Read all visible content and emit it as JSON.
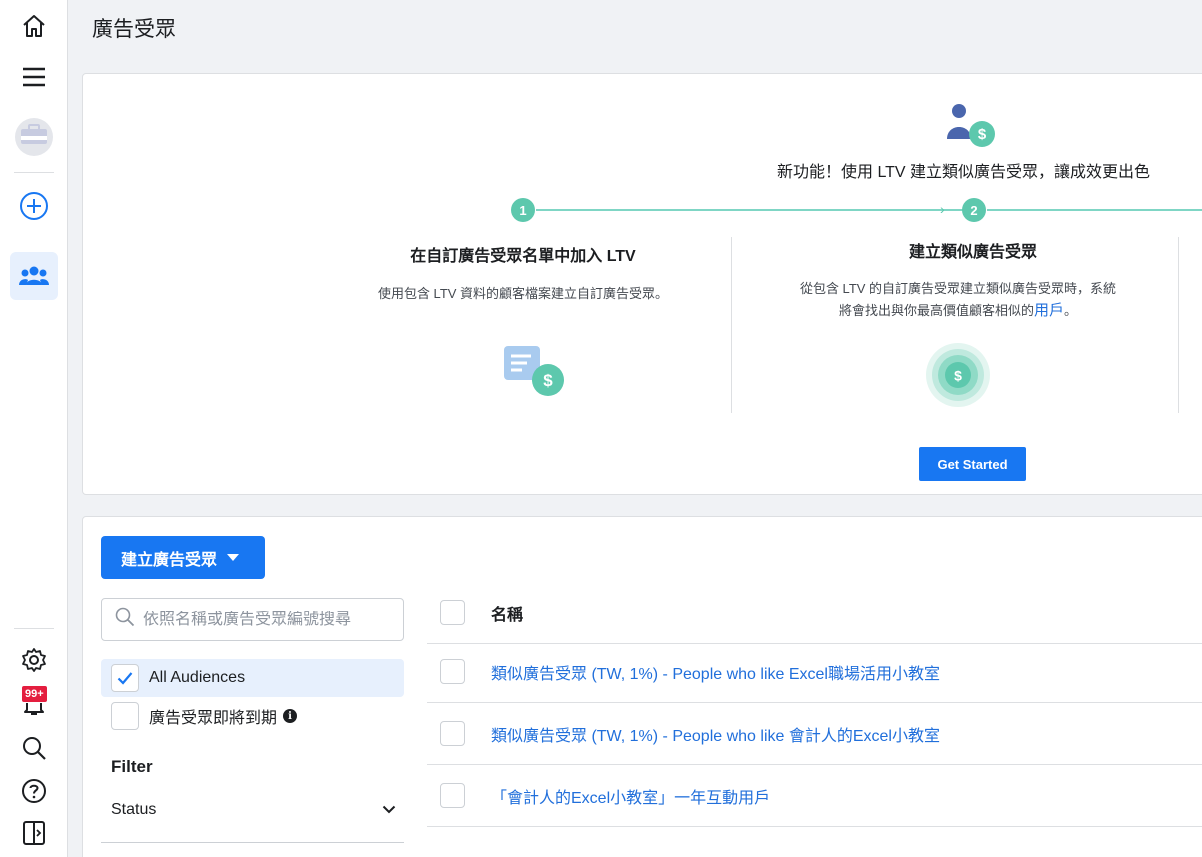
{
  "page": {
    "title": "廣告受眾"
  },
  "rail": {
    "items": [
      {
        "name": "home-icon"
      },
      {
        "name": "menu-icon"
      },
      {
        "name": "account-avatar"
      },
      {
        "name": "create-icon"
      },
      {
        "name": "audiences-icon",
        "active": true
      }
    ],
    "bottom": [
      {
        "name": "settings-icon"
      },
      {
        "name": "notifications-icon"
      },
      {
        "name": "search-icon"
      },
      {
        "name": "help-icon"
      },
      {
        "name": "panel-toggle-icon"
      }
    ],
    "notification_badge": "99+"
  },
  "promo": {
    "headline": "新功能！使用 LTV 建立類似廣告受眾，讓成效更出色",
    "steps": [
      {
        "number": "1",
        "title": "在自訂廣告受眾名單中加入 LTV",
        "description": "使用包含 LTV 資料的顧客檔案建立自訂廣告受眾。"
      },
      {
        "number": "2",
        "title": "建立類似廣告受眾",
        "description_line1": "從包含 LTV 的自訂廣告受眾建立類似廣告受眾時，系統",
        "description_line2": "將會找出與你最高價值顧客相似的",
        "description_link": "用戶",
        "description_end": "。"
      }
    ],
    "cta": "Get Started"
  },
  "audiences": {
    "create_button": "建立廣告受眾",
    "search_placeholder": "依照名稱或廣告受眾編號搜尋",
    "views": [
      {
        "label": "All Audiences",
        "checked": true
      },
      {
        "label": "廣告受眾即將到期",
        "checked": false
      }
    ],
    "filter_title": "Filter",
    "filters": [
      {
        "label": "Status"
      }
    ],
    "table": {
      "header": "名稱",
      "rows": [
        {
          "name": "類似廣告受眾 (TW, 1%) - People who like Excel職場活用小教室"
        },
        {
          "name": "類似廣告受眾 (TW, 1%) - People who like 會計人的Excel小教室"
        },
        {
          "name": "「會計人的Excel小教室」一年互動用戶"
        }
      ]
    }
  },
  "colors": {
    "brand": "#1877f2",
    "link": "#216fdb",
    "teal": "#5dc8ad",
    "badge": "#e41e3f"
  }
}
